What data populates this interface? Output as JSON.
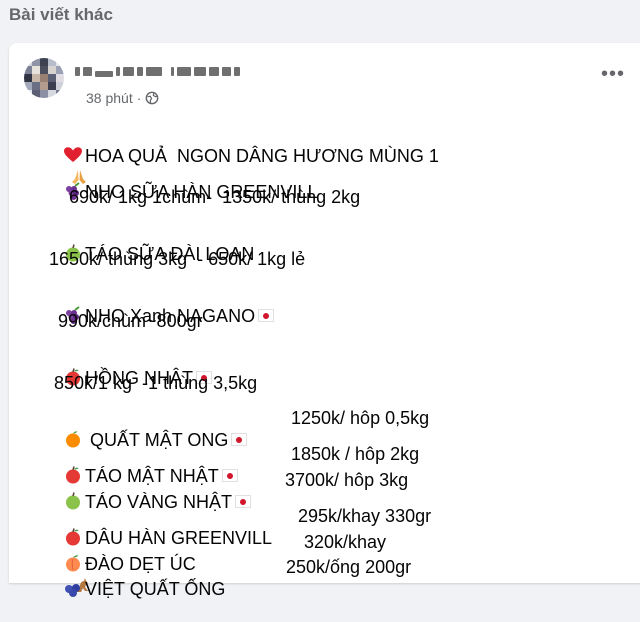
{
  "section_title": "Bài viết khác",
  "post": {
    "author_name": "",
    "time": "38 phút",
    "separator": "·",
    "lines": [
      "HOA QUẢ  NGON DÂNG HƯƠNG MÙNG 1",
      "NHO SỮA HÀN GREENVILL",
      "690k/ 1kg 1chùm-  1350k/ thùng 2kg",
      "TÁO SỮA ĐÀI LOAN",
      "1650k/ thùng 3kg  - 650k/ 1kg lẻ",
      "NHO Xanh NAGANO",
      "990k/chùm~800gr",
      "HỒNG NHẬT",
      "850k/1 kg  -1 thùng 3,5kg",
      "QUẤT MẬT ONG",
      "1250k/ hôp 0,5kg",
      "TÁO MẬT NHẬT",
      "1850k / hôp 2kg",
      "TÁO VÀNG NHẬT",
      "3700k/ hôp 3kg",
      "DÂU HÀN GREENVILL",
      "295k/khay 330gr",
      "ĐÀO DẸT ÚC",
      "320k/khay",
      "VIỆT QUẤT ỐNG",
      "250k/ống 200gr"
    ]
  },
  "icons": {
    "heart": "red-heart-icon",
    "pray": "folded-hands-icon",
    "grapes": "grapes-icon",
    "green_apple": "green-apple-icon",
    "red_apple": "red-apple-icon",
    "tangerine": "tangerine-icon",
    "peach": "peach-icon",
    "kangaroo": "kangaroo-icon",
    "blueberries": "blueberries-icon",
    "japan_flag": "japan-flag-icon",
    "globe": "globe-icon",
    "more": "more-options-icon"
  },
  "colors": {
    "page_bg": "#f0f2f5",
    "card_bg": "#ffffff",
    "secondary_text": "#65676b"
  }
}
